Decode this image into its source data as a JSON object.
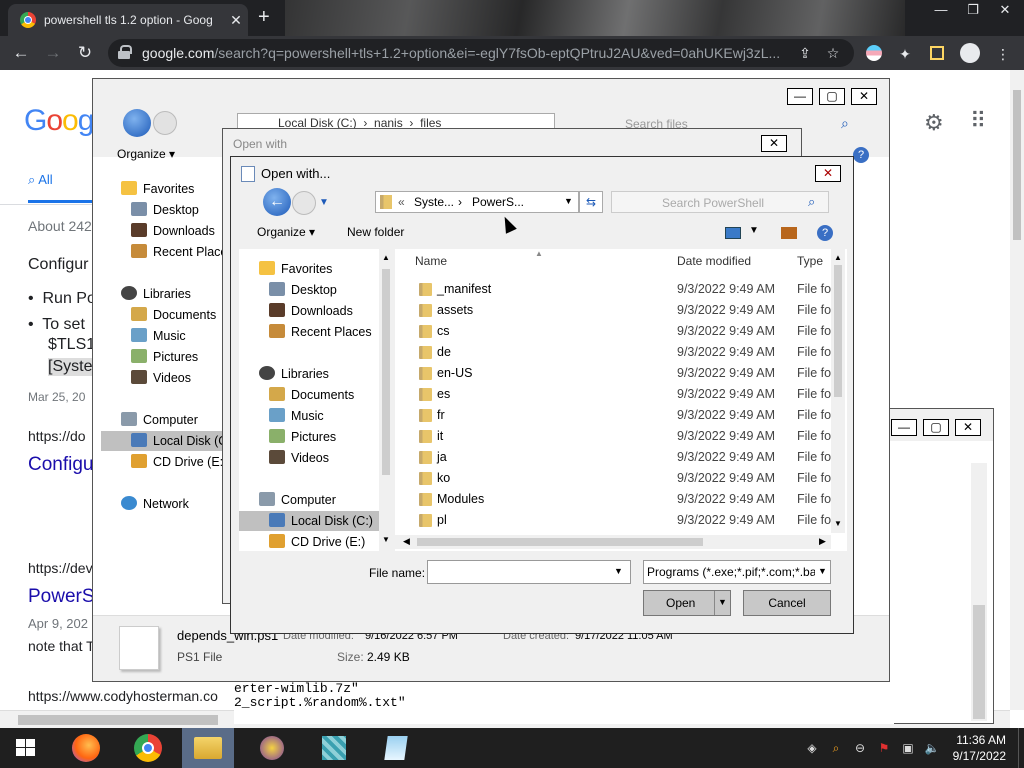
{
  "browser": {
    "tab_title": "powershell tls 1.2 option - Goog",
    "tab_close": "✕",
    "new_tab": "+",
    "url_host": "google.com",
    "url_rest": "/search?q=powershell+tls+1.2+option&ei=-eglY7fsOb-eptQPtruJ2AU&ved=0ahUKEwj3zL..."
  },
  "google": {
    "logo": "Goog",
    "tab_all": "All",
    "about": "About 242",
    "heading": "Configur",
    "bullet1": "Run Po",
    "bullet2": "To set",
    "bullet2b": "$TLS1",
    "bullet2c": "[Syste",
    "date1": "Mar 25, 20",
    "url1": "https://do",
    "link1": "Configu",
    "url2": "https://dev",
    "link2": "PowerS",
    "date2": "Apr 9, 202",
    "note": "note that T",
    "url3": "https://www.codyhosterman.co"
  },
  "explorer_back": {
    "organize": "Organize",
    "breadcrumb": [
      "«",
      "Local Disk (C:)",
      "›",
      "nanis",
      "›",
      "files"
    ],
    "search_placeholder": "Search files",
    "nav": {
      "favorites": "Favorites",
      "desktop": "Desktop",
      "downloads": "Downloads",
      "recent": "Recent Places",
      "libraries": "Libraries",
      "documents": "Documents",
      "music": "Music",
      "pictures": "Pictures",
      "videos": "Videos",
      "computer": "Computer",
      "local_disk": "Local Disk (C:",
      "cd_drive": "CD Drive (E:)",
      "network": "Network"
    },
    "details": {
      "file_name": "depends_win.ps1",
      "date_modified_label": "Date modified:",
      "date_modified": "9/16/2022 6:57 PM",
      "date_created_label": "Date created:",
      "date_created": "9/17/2022 11:05 AM",
      "type": "PS1 File",
      "size_label": "Size:",
      "size": "2.49 KB"
    }
  },
  "notepad": {
    "line1": "erter-wimlib.7z\"",
    "line2": "2_script.%random%.txt\""
  },
  "open_with_bg": {
    "title": "Open with"
  },
  "open_dialog": {
    "title": "Open with...",
    "breadcrumb": [
      "«",
      "Syste...",
      "›",
      "PowerS..."
    ],
    "search_placeholder": "Search PowerShell",
    "organize": "Organize",
    "new_folder": "New folder",
    "nav": {
      "favorites": "Favorites",
      "desktop": "Desktop",
      "downloads": "Downloads",
      "recent": "Recent Places",
      "libraries": "Libraries",
      "documents": "Documents",
      "music": "Music",
      "pictures": "Pictures",
      "videos": "Videos",
      "computer": "Computer",
      "local_disk": "Local Disk (C:)",
      "cd_drive": "CD Drive (E:)"
    },
    "columns": {
      "name": "Name",
      "date": "Date modified",
      "type": "Type"
    },
    "files": [
      {
        "name": "_manifest",
        "date": "9/3/2022 9:49 AM",
        "type": "File fol"
      },
      {
        "name": "assets",
        "date": "9/3/2022 9:49 AM",
        "type": "File fol"
      },
      {
        "name": "cs",
        "date": "9/3/2022 9:49 AM",
        "type": "File fol"
      },
      {
        "name": "de",
        "date": "9/3/2022 9:49 AM",
        "type": "File fol"
      },
      {
        "name": "en-US",
        "date": "9/3/2022 9:49 AM",
        "type": "File fol"
      },
      {
        "name": "es",
        "date": "9/3/2022 9:49 AM",
        "type": "File fol"
      },
      {
        "name": "fr",
        "date": "9/3/2022 9:49 AM",
        "type": "File fol"
      },
      {
        "name": "it",
        "date": "9/3/2022 9:49 AM",
        "type": "File fol"
      },
      {
        "name": "ja",
        "date": "9/3/2022 9:49 AM",
        "type": "File fol"
      },
      {
        "name": "ko",
        "date": "9/3/2022 9:49 AM",
        "type": "File fol"
      },
      {
        "name": "Modules",
        "date": "9/3/2022 9:49 AM",
        "type": "File fol"
      },
      {
        "name": "pl",
        "date": "9/3/2022 9:49 AM",
        "type": "File fol"
      }
    ],
    "file_name_label": "File name:",
    "file_name_value": "",
    "filter": "Programs (*.exe;*.pif;*.com;*.ba",
    "open_button": "Open",
    "cancel_button": "Cancel"
  },
  "taskbar": {
    "time": "11:36 AM",
    "date": "9/17/2022"
  },
  "colors": {
    "chrome_dark": "#202124",
    "chrome_toolbar": "#35363a",
    "link_blue": "#1a0dab",
    "selection": "#c0c0c0",
    "taskbar": "#1f1f1f"
  }
}
